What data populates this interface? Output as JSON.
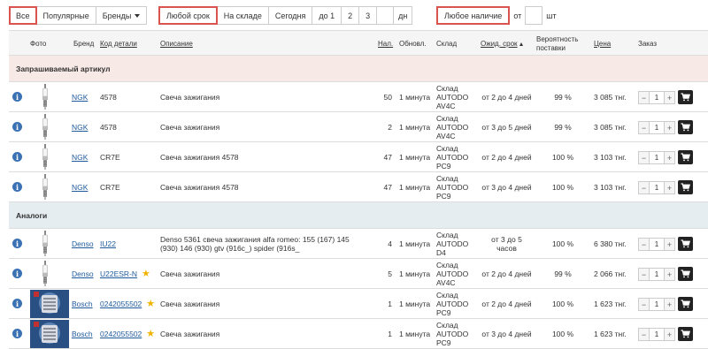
{
  "filters": {
    "all": "Все",
    "popular": "Популярные",
    "brands": "Бренды",
    "any_term": "Любой срок",
    "in_stock": "На складе",
    "today": "Сегодня",
    "to1": "до 1",
    "d2": "2",
    "d3": "3",
    "days_unit": "дн",
    "any_availability": "Любое наличие",
    "from": "от",
    "pcs_unit": "шт"
  },
  "headers": {
    "photo": "Фото",
    "brand": "Бренд",
    "code": "Код детали",
    "description": "Описание",
    "avail": "Нал.",
    "updated": "Обновл.",
    "warehouse": "Склад",
    "expected": "Ожид. срок",
    "probability": "Вероятность поставки",
    "price": "Цена",
    "order": "Заказ"
  },
  "sections": {
    "requested": "Запрашиваемый артикул",
    "analogs": "Аналоги"
  },
  "requested_rows": [
    {
      "brand": "NGK",
      "code": "4578",
      "desc": "Свеча зажигания",
      "avail": "50",
      "updated": "1 минута",
      "stock": [
        "Склад",
        "AUTODO",
        "AV4C"
      ],
      "term": "от 2 до 4 дней",
      "prob": "99 %",
      "price": "3 085 тнг.",
      "qty": "1"
    },
    {
      "brand": "NGK",
      "code": "4578",
      "desc": "Свеча зажигания",
      "avail": "2",
      "updated": "1 минута",
      "stock": [
        "Склад",
        "AUTODO",
        "AV4C"
      ],
      "term": "от 3 до 5 дней",
      "prob": "99 %",
      "price": "3 085 тнг.",
      "qty": "1"
    },
    {
      "brand": "NGK",
      "code": "CR7E",
      "desc": "Свеча зажигания 4578",
      "avail": "47",
      "updated": "1 минута",
      "stock": [
        "Склад",
        "AUTODO",
        "PC9"
      ],
      "term": "от 2 до 4 дней",
      "prob": "100 %",
      "price": "3 103 тнг.",
      "qty": "1"
    },
    {
      "brand": "NGK",
      "code": "CR7E",
      "desc": "Свеча зажигания 4578",
      "avail": "47",
      "updated": "1 минута",
      "stock": [
        "Склад",
        "AUTODO",
        "PC9"
      ],
      "term": "от 3 до 4 дней",
      "prob": "100 %",
      "price": "3 103 тнг.",
      "qty": "1"
    }
  ],
  "analog_rows": [
    {
      "brand": "Denso",
      "code": "IU22",
      "desc1": "Denso 5361 свеча зажигания alfa romeo: 155 (167) 145",
      "desc2": "(930) 146 (930) gtv (916c_) spider (916s_",
      "avail": "4",
      "updated": "1 минута",
      "stock": [
        "Склад",
        "AUTODO",
        "D4"
      ],
      "term1": "от 3 до 5",
      "term2": "часов",
      "prob": "100 %",
      "price": "6 380 тнг.",
      "qty": "1"
    },
    {
      "brand": "Denso",
      "code": "U22ESR-N",
      "desc1": "Свеча зажигания",
      "desc2": "",
      "avail": "5",
      "updated": "1 минута",
      "stock": [
        "Склад",
        "AUTODO",
        "AV4C"
      ],
      "term1": "от 2 до 4 дней",
      "term2": "",
      "prob": "99 %",
      "price": "2 066 тнг.",
      "qty": "1"
    },
    {
      "brand": "Bosch",
      "code": "0242055502",
      "desc1": "Свеча зажигания",
      "desc2": "",
      "avail": "1",
      "updated": "1 минута",
      "stock": [
        "Склад",
        "AUTODO",
        "PC9"
      ],
      "term1": "от 2 до 4 дней",
      "term2": "",
      "prob": "100 %",
      "price": "1 623 тнг.",
      "qty": "1"
    },
    {
      "brand": "Bosch",
      "code": "0242055502",
      "desc1": "Свеча зажигания",
      "desc2": "",
      "avail": "1",
      "updated": "1 минута",
      "stock": [
        "Склад",
        "AUTODO",
        "PC9"
      ],
      "term1": "от 3 до 4 дней",
      "term2": "",
      "prob": "100 %",
      "price": "1 623 тнг.",
      "qty": "1"
    }
  ],
  "colors": {
    "accent_red": "#d9534f",
    "link_blue": "#1e5a9c",
    "info_blue": "#3b72b4",
    "star_yellow": "#f0b400"
  }
}
